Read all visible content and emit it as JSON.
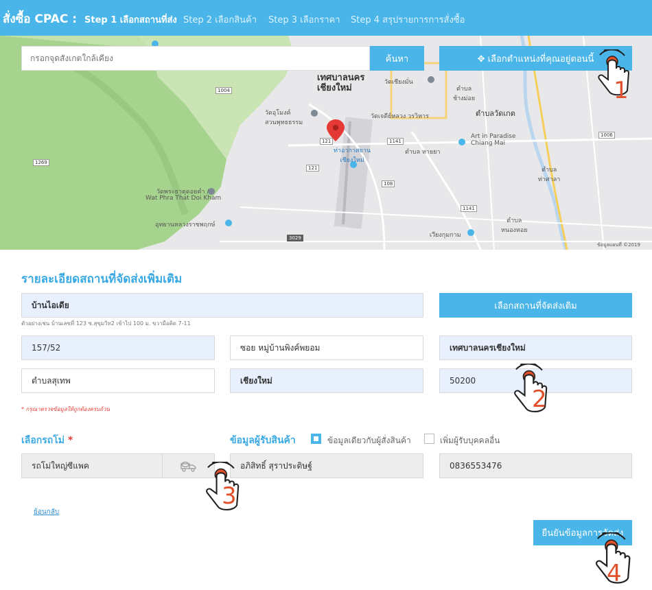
{
  "header": {
    "brand": "สั่งซื้อ CPAC :",
    "steps": [
      {
        "label": "Step 1 เลือกสถานที่ส่ง",
        "active": true
      },
      {
        "label": "Step 2 เลือกสินค้า",
        "active": false
      },
      {
        "label": "Step 3 เลือกราคา",
        "active": false
      },
      {
        "label": "Step 4 สรุปรายการการสั่งซื้อ",
        "active": false
      }
    ]
  },
  "map": {
    "search_placeholder": "กรอกจุดสังเกตใกล้เคียง",
    "search_label": "ค้นหา",
    "locate_label": "✥ เลือกตำแหน่งที่คุณอยู่ตอนนี้",
    "attribution": "ข้อมูลแผนที่ ©2019",
    "labels": {
      "city": "เทศบาลนคร\nเชียงใหม่",
      "temple": "วัดอุโมงค์\nสวนพุทธธรรม",
      "doi_kham_th": "วัดพระธาตุดอยคำ /",
      "doi_kham_en": "Wat Phra That Doi Kham",
      "airport": "ท่าอากาศยาน\nเชียงใหม่",
      "art": "Art in Paradise\nChiang Mai",
      "chedi": "วัดเจดีย์หลวง วรวิหาร",
      "wat_ket": "ตำบลวัดเกต",
      "hai_ya": "ตำบล หายยา",
      "pa_daet": "ตำบล\nท่าศาลา",
      "nong_hoi": "ตำบล\nหนองหอย",
      "chang_moi": "ตำบล\nช้างม่อย",
      "wiang_kum_kam": "เวียงกุมกาม",
      "park": "อุทยานหลวงราชพฤกษ์",
      "chiang_man": "วัดเชียงมั่น"
    },
    "roads": [
      "1004",
      "121",
      "1141",
      "108",
      "3029",
      "1269",
      "1006",
      "1141",
      "121"
    ]
  },
  "details": {
    "title": "รายละเอียดสถานที่จัดส่งเพิ่มเติม",
    "place_name": "บ้านไอเดีย",
    "hint": "ตัวอย่างเช่น บ้านเลขที่ 123 ซ.สุขุมวิท2 เข้าไป 100 ม. ขวามือติด 7-11",
    "choose_old_label": "เลือกสถานที่จัดส่งเดิม",
    "house_no": "157/52",
    "soi": "ซอย หมู่บ้านพิงค์พยอม",
    "district_city": "เทศบาลนครเชียงใหม่",
    "subdistrict": "ตำบลสุเทพ",
    "province": "เชียงใหม่",
    "postcode": "50200",
    "warning": "* กรุณาตรวจข้อมูลให้ถูกต้องครบถ้วน"
  },
  "truck": {
    "title": "เลือกรถโม่",
    "required": "*",
    "value": "รถโม่ใหญ่ซีแพค"
  },
  "receiver": {
    "title": "ข้อมูลผู้รับสินค้า",
    "same_label": "ข้อมูลเดียวกับผู้สั่งสินค้า",
    "add_label": "เพิ่มผู้รับบุคคลอื่น",
    "name": "อภิสิทธิ์ สุราประดิษฐ์",
    "phone": "0836553476"
  },
  "footer": {
    "back_label": "ย้อนกลับ",
    "confirm_label": "ยืนยันข้อมูลการจัดส่ง"
  },
  "callouts": [
    "1",
    "2",
    "3",
    "4"
  ],
  "colors": {
    "accent": "#4ab5e8",
    "title": "#3aa9e3",
    "required": "#e53935",
    "callout": "#e0502b"
  }
}
